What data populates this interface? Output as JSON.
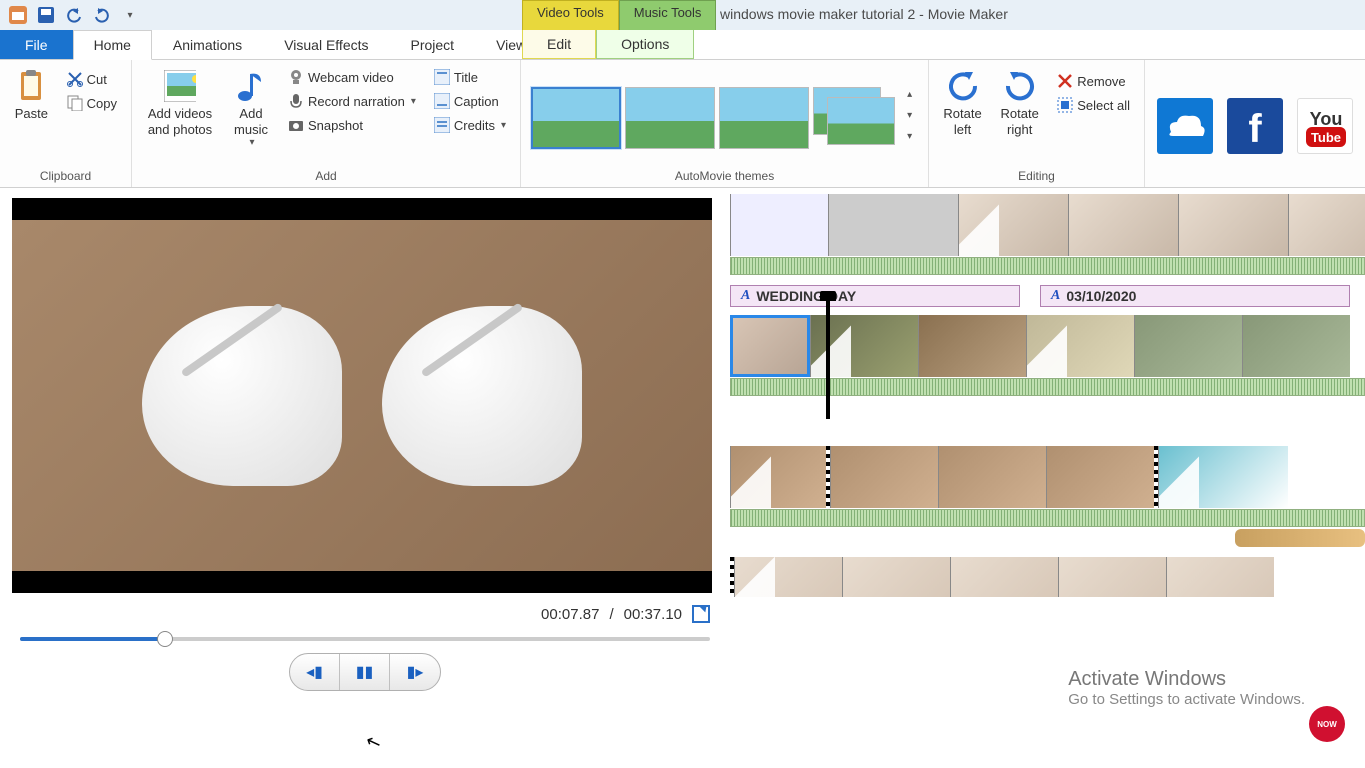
{
  "title": "windows movie maker tutorial 2 - Movie Maker",
  "context_tabs": {
    "video": "Video Tools",
    "music": "Music Tools",
    "edit": "Edit",
    "options": "Options"
  },
  "tabs": {
    "file": "File",
    "home": "Home",
    "animations": "Animations",
    "vfx": "Visual Effects",
    "project": "Project",
    "view": "View"
  },
  "clipboard": {
    "paste": "Paste",
    "cut": "Cut",
    "copy": "Copy",
    "group": "Clipboard"
  },
  "add": {
    "videos": "Add videos and photos",
    "music": "Add music",
    "webcam": "Webcam video",
    "narration": "Record narration",
    "snapshot": "Snapshot",
    "title": "Title",
    "caption": "Caption",
    "credits": "Credits",
    "group": "Add"
  },
  "automovie": {
    "group": "AutoMovie themes"
  },
  "editing": {
    "rotate_left": "Rotate left",
    "rotate_right": "Rotate right",
    "remove": "Remove",
    "select_all": "Select all",
    "group": "Editing"
  },
  "player": {
    "current": "00:07.87",
    "total": "00:37.10",
    "sep": "/"
  },
  "timeline": {
    "caption1": "WEDDING DAY",
    "caption2": "03/10/2020"
  },
  "watermark": {
    "heading": "Activate Windows",
    "sub": "Go to Settings to activate Windows."
  },
  "badge": "NOW"
}
